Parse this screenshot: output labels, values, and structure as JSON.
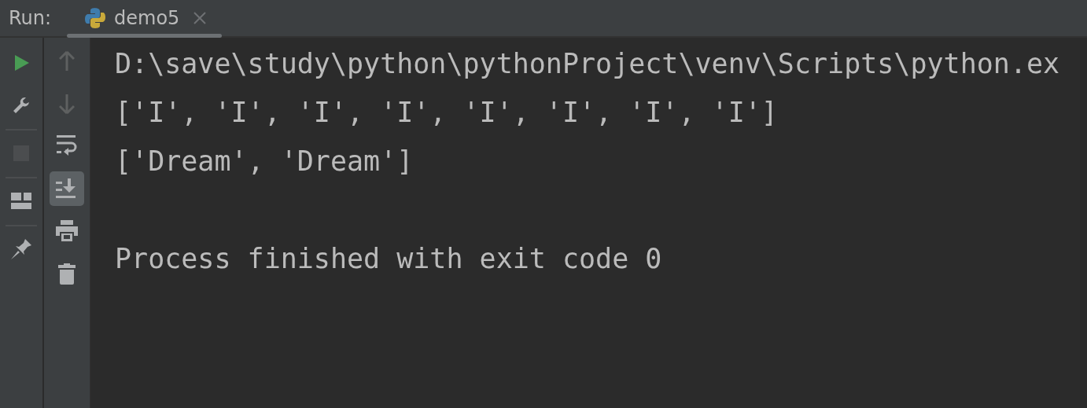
{
  "header": {
    "title": "Run:"
  },
  "tabs": [
    {
      "label": "demo5",
      "selected": true
    }
  ],
  "left_toolbar": [
    {
      "kind": "run",
      "disabled": false
    },
    {
      "kind": "settings"
    },
    {
      "kind": "divider"
    },
    {
      "kind": "stop",
      "disabled": true
    },
    {
      "kind": "divider"
    },
    {
      "kind": "layout"
    },
    {
      "kind": "divider"
    },
    {
      "kind": "pin"
    }
  ],
  "right_toolbar": [
    {
      "kind": "up",
      "disabled": true
    },
    {
      "kind": "down",
      "disabled": true
    },
    {
      "kind": "wrap",
      "on": false
    },
    {
      "kind": "scroll-end",
      "on": true
    },
    {
      "kind": "print"
    },
    {
      "kind": "trash"
    }
  ],
  "console": {
    "lines": [
      "D:\\save\\study\\python\\pythonProject\\venv\\Scripts\\python.ex",
      "['I', 'I', 'I', 'I', 'I', 'I', 'I', 'I']",
      "['Dream', 'Dream']"
    ],
    "status": "Process finished with exit code 0"
  }
}
